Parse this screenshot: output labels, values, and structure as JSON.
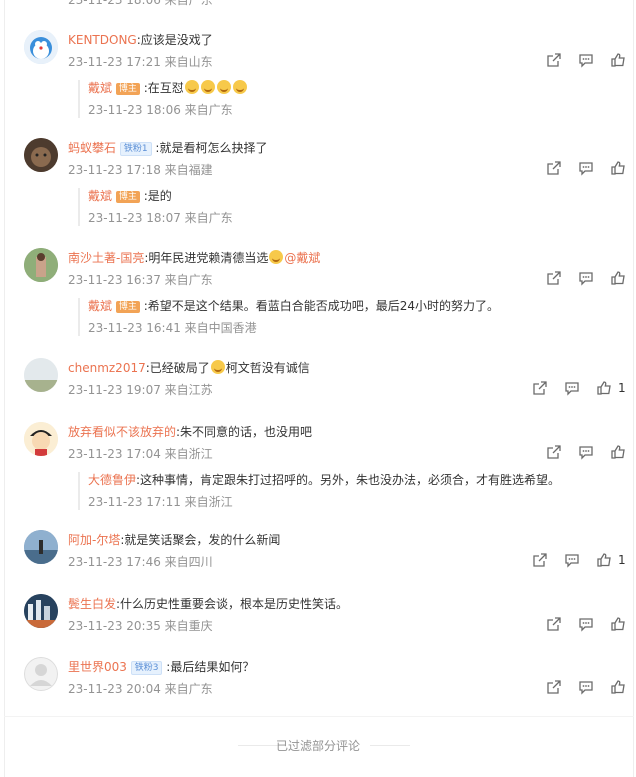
{
  "top_partial_meta": "23-11-23 18:06 来自广东",
  "comments": [
    {
      "user": "KENTDONG",
      "text": ":应该是没戏了",
      "meta": "23-11-23 17:21 来自山东",
      "likes": "",
      "reply": {
        "user": "戴斌",
        "badge": "博主",
        "text_before": ":在互怼",
        "emojis": 4,
        "meta": "23-11-23 18:06 来自广东"
      }
    },
    {
      "user": "蚂蚁攀石",
      "fan_badge": "铁粉1",
      "text": ":就是看柯怎么抉择了",
      "meta": "23-11-23 17:18 来自福建",
      "likes": "",
      "reply": {
        "user": "戴斌",
        "badge": "博主",
        "text_before": ":是的",
        "emojis": 0,
        "meta": "23-11-23 18:07 来自广东"
      }
    },
    {
      "user": "南沙土著-国亮",
      "text": ":明年民进党赖清德当选",
      "mention": "@戴斌",
      "meta": "23-11-23 16:37 来自广东",
      "likes": "",
      "reply": {
        "user": "戴斌",
        "badge": "博主",
        "text_before": ":希望不是这个结果。看蓝白合能否成功吧，最后24小时的努力了。",
        "emojis": 0,
        "meta": "23-11-23 16:41 来自中国香港"
      }
    },
    {
      "user": "chenmz2017",
      "text": ":已经破局了",
      "text_after": "柯文哲没有诚信",
      "meta": "23-11-23 19:07 来自江苏",
      "likes": "1"
    },
    {
      "user": "放弃看似不该放弃的",
      "text": ":朱不同意的话，也没用吧",
      "meta": "23-11-23 17:04 来自浙江",
      "likes": "",
      "reply": {
        "user": "大德鲁伊",
        "badge": "",
        "text_before": ":这种事情，肯定跟朱打过招呼的。另外，朱也没办法，必须合，才有胜选希望。",
        "emojis": 0,
        "meta": "23-11-23 17:11 来自浙江"
      }
    },
    {
      "user": "阿加-尔塔",
      "text": ":就是笑话聚会，发的什么新闻",
      "meta": "23-11-23 17:46 来自四川",
      "likes": "1"
    },
    {
      "user": "鬓生白发",
      "text": ":什么历史性重要会谈，根本是历史性笑话。",
      "meta": "23-11-23 20:35 来自重庆",
      "likes": ""
    },
    {
      "user": "里世界003",
      "fan_badge": "铁粉3",
      "text": ":最后结果如何？",
      "meta": "23-11-23 20:04 来自广东",
      "likes": ""
    }
  ],
  "footer": "已过滤部分评论",
  "icons": {
    "share": "share-icon",
    "comment": "comment-icon",
    "like": "like-icon"
  },
  "colors": {
    "username": "#eb7350",
    "meta": "#939393",
    "host_badge": "#f2a356"
  }
}
